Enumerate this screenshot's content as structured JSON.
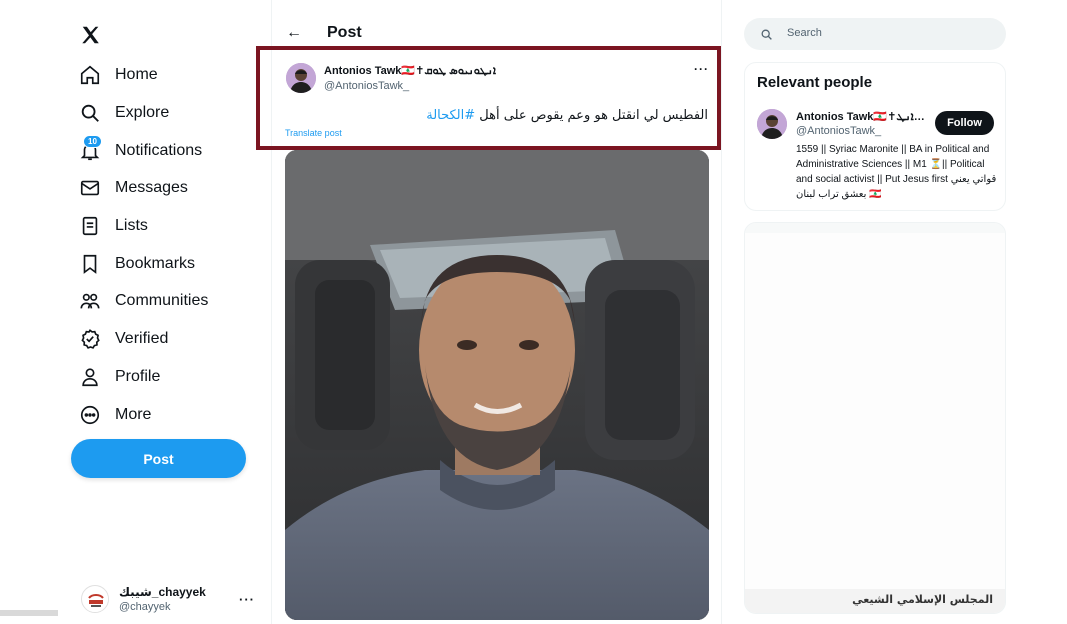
{
  "nav": {
    "items": [
      {
        "label": "Home",
        "icon": "home-icon"
      },
      {
        "label": "Explore",
        "icon": "search-icon"
      },
      {
        "label": "Notifications",
        "icon": "bell-icon",
        "badge": "10"
      },
      {
        "label": "Messages",
        "icon": "mail-icon"
      },
      {
        "label": "Lists",
        "icon": "list-icon"
      },
      {
        "label": "Bookmarks",
        "icon": "bookmark-icon"
      },
      {
        "label": "Communities",
        "icon": "people-icon"
      },
      {
        "label": "Verified",
        "icon": "verified-icon"
      },
      {
        "label": "Profile",
        "icon": "person-icon"
      },
      {
        "label": "More",
        "icon": "more-circle-icon"
      }
    ],
    "post_button": "Post"
  },
  "account": {
    "name": "شيبك_chayyek",
    "handle": "@chayyek",
    "more": "···"
  },
  "header": {
    "back": "←",
    "title": "Post"
  },
  "tweet": {
    "author_name": "Antonios Tawk🇱🇧✝︎ܐܢܛܘܢܝܘܣ ܛܘܩ",
    "author_handle": "@AntoniosTawk_",
    "more": "···",
    "text": "الفطيس لي انقتل هو وعم يقوص على أهل",
    "hashtag": "#الكحالة",
    "translate": "Translate post"
  },
  "right": {
    "search_placeholder": "Search",
    "relevant_title": "Relevant people",
    "person": {
      "name": "Antonios Tawk🇱🇧✝︎ܐܢܛ…",
      "handle": "@AntoniosTawk_",
      "follow": "Follow",
      "bio": "1559 || Syriac Maronite || BA in Political and Administrative Sciences || M1 ⏳|| Political and social activist || Put Jesus first قواتي يعني بعشق تراب لبنان 🇱🇧"
    },
    "card_caption": "المجلس الإسلامي الشيعي"
  },
  "colors": {
    "accent": "#1d9bf0",
    "highlight_border": "#7b1521",
    "text": "#0f1419",
    "muted": "#536471"
  }
}
